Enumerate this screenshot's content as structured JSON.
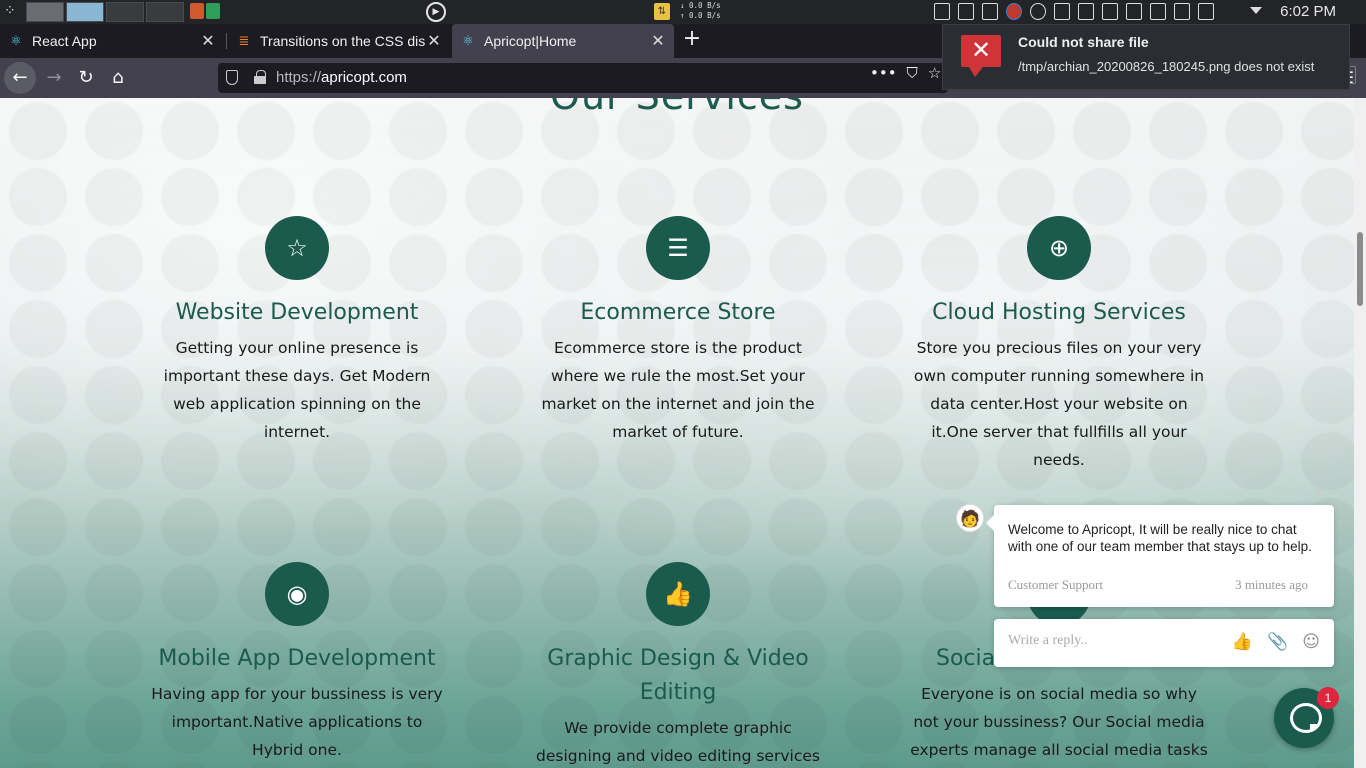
{
  "os_panel": {
    "net_up": "0.0 B/s",
    "net_down": "0.0 B/s",
    "clock": "6:02 PM"
  },
  "tabs": [
    {
      "title": "React App",
      "icon": "react-icon"
    },
    {
      "title": "Transitions on the CSS disp",
      "icon": "stackoverflow-icon"
    },
    {
      "title": "Apricopt|Home",
      "icon": "react-icon"
    }
  ],
  "urlbar": {
    "protocol": "https://",
    "domain": "apricopt.com"
  },
  "notification": {
    "title": "Could not share file",
    "body": "/tmp/archian_20200826_180245.png does not exist"
  },
  "page": {
    "heading": "Our Services",
    "services": [
      {
        "title": "Website Development",
        "icon": "star-list-icon",
        "desc": "Getting your online presence is important these days. Get Modern web application spinning on the internet."
      },
      {
        "title": "Ecommerce Store",
        "icon": "document-icon",
        "desc": "Ecommerce store is the product where we rule the most.Set your market on the internet and join the market of future."
      },
      {
        "title": "Cloud Hosting Services",
        "icon": "globe-icon",
        "desc": "Store you precious files on your very own computer running somewhere in data center.Host your website on it.One server that fullfills all your needs."
      },
      {
        "title": "Mobile App Development",
        "icon": "head-icon",
        "desc": "Having app for your bussiness is very important.Native applications to Hybrid one."
      },
      {
        "title": "Graphic Design & Video Editing",
        "icon": "thumbs-up-icon",
        "desc": "We provide complete graphic designing and video editing services"
      },
      {
        "title": "Socia",
        "icon": "social-icon",
        "desc": "Everyone is on social media so why not your bussiness? Our Social media experts manage all social media tasks"
      }
    ]
  },
  "chat": {
    "message": "Welcome to Apricopt, It will be really nice to chat with one of our team member that stays up to help.",
    "sender": "Customer Support",
    "time_ago": "3 minutes ago",
    "reply_placeholder": "Write a reply..",
    "badge_count": "1"
  }
}
